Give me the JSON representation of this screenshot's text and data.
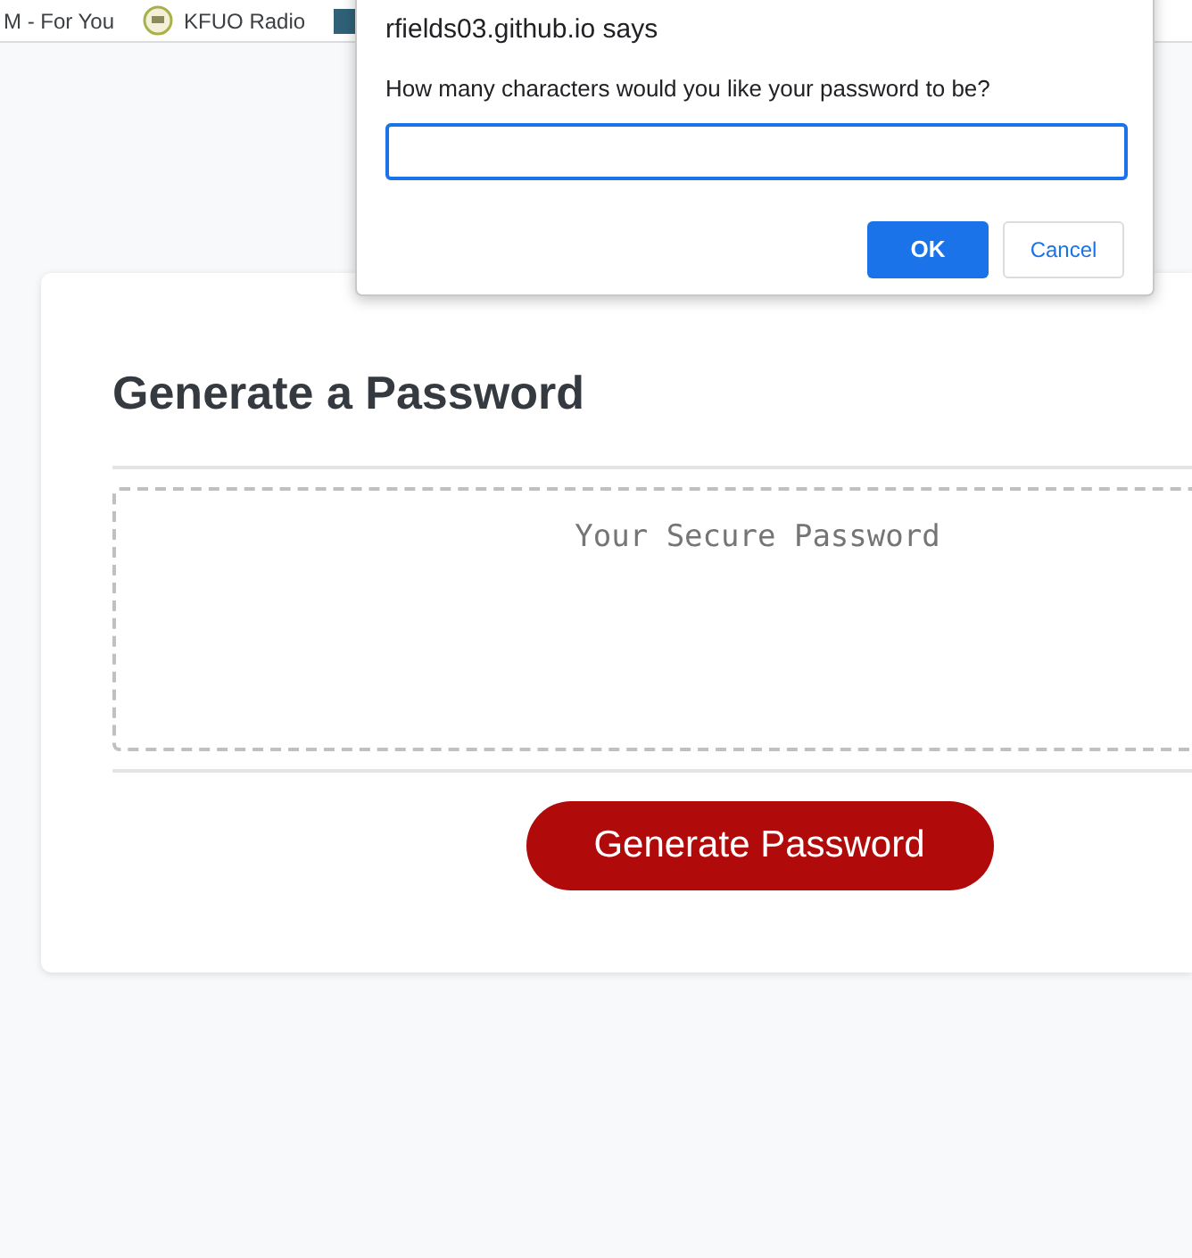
{
  "bookmarks_bar": {
    "items": [
      {
        "label": "M - For You",
        "kind": "text"
      },
      {
        "label": "KFUO Radio",
        "kind": "round"
      },
      {
        "kind": "square"
      }
    ]
  },
  "card": {
    "title": "Generate a Password",
    "password_field": {
      "placeholder": "Your Secure Password"
    },
    "button": "Generate Password"
  },
  "dialog": {
    "title": "rfields03.github.io says",
    "message": "How many characters would you like your password to be?",
    "input": {
      "focused": true
    },
    "buttons": [
      {
        "label": "OK",
        "kind": "primary"
      },
      {
        "label": "Cancel",
        "kind": "secondary"
      }
    ]
  }
}
